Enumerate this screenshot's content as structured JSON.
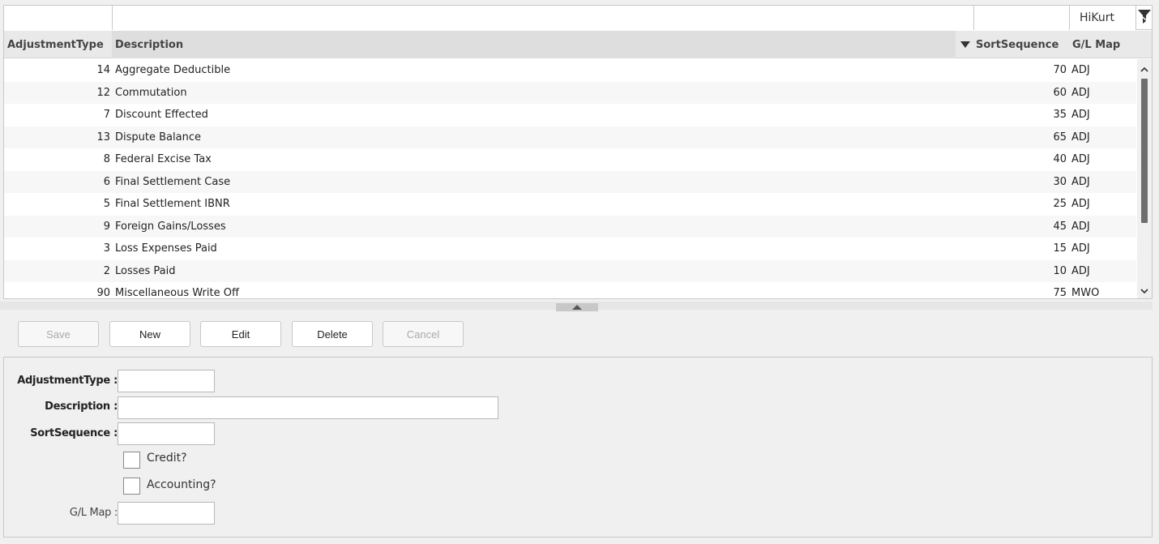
{
  "grid": {
    "filter_value": "HiKurt",
    "columns": [
      "AdjustmentType",
      "Description",
      "SortSequence",
      "G/L Map"
    ],
    "rows": [
      {
        "type": "14",
        "description": "Aggregate Deductible",
        "sort": "70",
        "gl": "ADJ"
      },
      {
        "type": "12",
        "description": "Commutation",
        "sort": "60",
        "gl": "ADJ"
      },
      {
        "type": "7",
        "description": "Discount Effected",
        "sort": "35",
        "gl": "ADJ"
      },
      {
        "type": "13",
        "description": "Dispute Balance",
        "sort": "65",
        "gl": "ADJ"
      },
      {
        "type": "8",
        "description": "Federal Excise Tax",
        "sort": "40",
        "gl": "ADJ"
      },
      {
        "type": "6",
        "description": "Final Settlement Case",
        "sort": "30",
        "gl": "ADJ"
      },
      {
        "type": "5",
        "description": "Final Settlement IBNR",
        "sort": "25",
        "gl": "ADJ"
      },
      {
        "type": "9",
        "description": "Foreign Gains/Losses",
        "sort": "45",
        "gl": "ADJ"
      },
      {
        "type": "3",
        "description": "Loss Expenses Paid",
        "sort": "15",
        "gl": "ADJ"
      },
      {
        "type": "2",
        "description": "Losses Paid",
        "sort": "10",
        "gl": "ADJ"
      },
      {
        "type": "90",
        "description": "Miscellaneous Write Off",
        "sort": "75",
        "gl": "MWO"
      }
    ]
  },
  "toolbar": {
    "save": "Save",
    "new": "New",
    "edit": "Edit",
    "delete": "Delete",
    "cancel": "Cancel"
  },
  "form": {
    "adjustment_type_label": "AdjustmentType :",
    "description_label": "Description :",
    "sort_sequence_label": "SortSequence :",
    "credit_label": "Credit?",
    "accounting_label": "Accounting?",
    "gl_map_label": "G/L Map :"
  },
  "colors": {
    "header_bg": "#e9e9e9",
    "scroll_thumb": "#6e6e6e",
    "border": "#c8c8c8"
  }
}
